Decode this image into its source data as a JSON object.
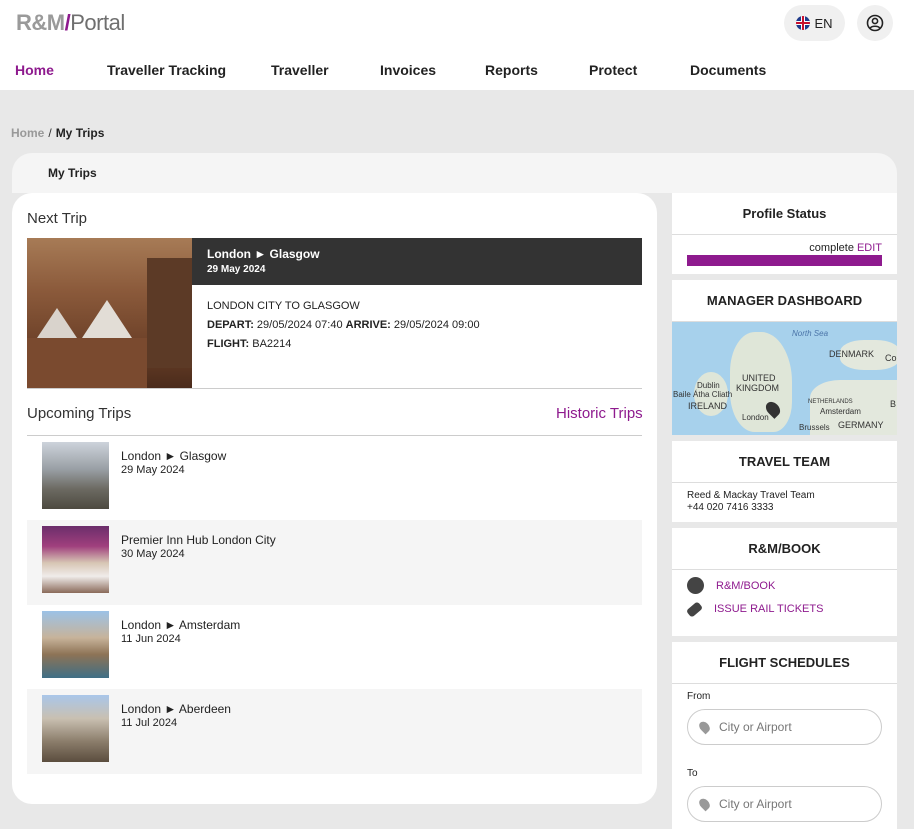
{
  "header": {
    "logo": {
      "part1": "R&M",
      "slash": "/",
      "part2": "Portal"
    },
    "language": "EN",
    "nav": [
      {
        "label": "Home"
      },
      {
        "label": "Traveller Tracking"
      },
      {
        "label": "Traveller"
      },
      {
        "label": "Invoices"
      },
      {
        "label": "Reports"
      },
      {
        "label": "Protect"
      },
      {
        "label": "Documents"
      }
    ]
  },
  "breadcrumb": {
    "home": "Home",
    "separator": "/",
    "current": "My Trips"
  },
  "page_title": "My Trips",
  "next_trip": {
    "heading": "Next Trip",
    "route": "London ► Glasgow",
    "date": "29 May 2024",
    "description": "LONDON CITY TO GLASGOW",
    "depart_label": "DEPART:",
    "depart": "29/05/2024 07:40",
    "arrive_label": "ARRIVE:",
    "arrive": "29/05/2024 09:00",
    "flight_label": "FLIGHT:",
    "flight": "BA2214"
  },
  "upcoming": {
    "heading": "Upcoming Trips",
    "historic_link": "Historic Trips",
    "trips": [
      {
        "title": "London ► Glasgow",
        "date": "29 May 2024"
      },
      {
        "title": "Premier Inn Hub London City",
        "date": "30 May 2024"
      },
      {
        "title": "London ► Amsterdam",
        "date": "11 Jun 2024"
      },
      {
        "title": "London ► Aberdeen",
        "date": "11 Jul 2024"
      }
    ]
  },
  "profile_status": {
    "heading": "Profile Status",
    "complete_label": "complete",
    "edit_label": "EDIT",
    "progress": 1.0,
    "bar_color": "#8e1a8e"
  },
  "manager_dashboard": {
    "heading": "MANAGER DASHBOARD",
    "map_labels": {
      "north_sea": "North Sea",
      "denmark": "DENMARK",
      "copenhagen": "Cop",
      "uk_line1": "UNITED",
      "uk_line2": "KINGDOM",
      "dublin": "Dublin",
      "baile": "Baile Átha Cliath",
      "ireland": "IRELAND",
      "london": "London",
      "netherlands": "NETHERLANDS",
      "amsterdam": "Amsterdam",
      "brussels": "Brussels",
      "germany": "GERMANY",
      "edge": "B"
    }
  },
  "travel_team": {
    "heading": "TRAVEL TEAM",
    "name": "Reed & Mackay Travel Team",
    "phone": "+44 020 7416 3333"
  },
  "rm_book": {
    "heading": "R&M/BOOK",
    "links": [
      {
        "label": "R&M/BOOK",
        "icon": "globe-icon"
      },
      {
        "label": "ISSUE RAIL TICKETS",
        "icon": "ticket-icon"
      }
    ]
  },
  "flight_schedules": {
    "heading": "FLIGHT SCHEDULES",
    "from_label": "From",
    "from_placeholder": "City or Airport",
    "to_label": "To",
    "to_placeholder": "City or Airport"
  },
  "colors": {
    "accent": "#8e1a8e",
    "dark_header": "#333333",
    "background": "#e8e8e8"
  }
}
